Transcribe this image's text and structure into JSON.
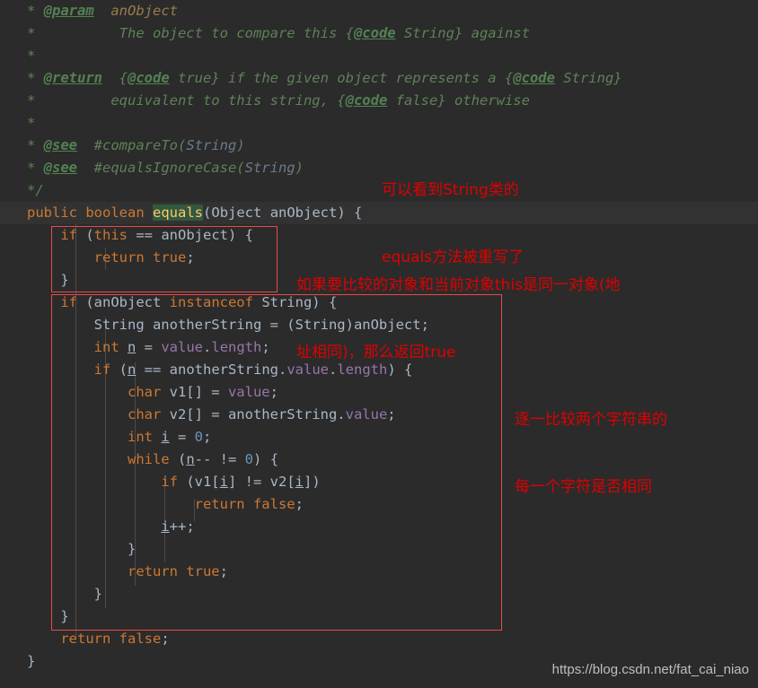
{
  "editor": {
    "theme": "darcula",
    "background_color": "#2b2b2b",
    "current_line_color": "#323232",
    "annotation_color": "#e00000",
    "box_color": "#e84a4a"
  },
  "javadoc": {
    "lines": [
      {
        "star": "*",
        "tag": "@param",
        "text_param": "anObject",
        "text_plain": ""
      },
      {
        "star": "*",
        "tag": "",
        "text_plain": "         The object to compare this {",
        "tag_inline": "@code",
        "text_after": " String} against"
      },
      {
        "star": "*",
        "tag": "",
        "text_plain": ""
      },
      {
        "star": "*",
        "tag": "@return",
        "text_plain": "  {",
        "tag_inline": "@code",
        "text_after": " true} if the given object represents a {",
        "tag_inline2": "@code",
        "text_after2": " String}"
      },
      {
        "star": "*",
        "tag": "",
        "text_plain": "        equivalent to this string, {",
        "tag_inline": "@code",
        "text_after": " false} otherwise"
      },
      {
        "star": "*",
        "tag": "",
        "text_plain": ""
      },
      {
        "star": "*",
        "tag": "@see",
        "text_plain": "  #compareTo(",
        "link": "String",
        "text_after": ")"
      },
      {
        "star": "*",
        "tag": "@see",
        "text_plain": "  #equalsIgnoreCase(",
        "link": "String",
        "text_after": ")"
      }
    ],
    "close": "*/"
  },
  "code": {
    "signature": {
      "modifier": "public",
      "return_type": "boolean",
      "method_name": "equals",
      "params_open": "(",
      "param_type": "Object",
      "param_name": " anObject",
      "params_close": ")",
      "brace": " {"
    },
    "lines": [
      {
        "id": "if-this-eq",
        "indent": 1,
        "tokens": [
          {
            "t": "kw",
            "v": "if"
          },
          {
            "t": "plain",
            "v": " ("
          },
          {
            "t": "kw",
            "v": "this"
          },
          {
            "t": "plain",
            "v": " == anObject)"
          },
          {
            "t": "brace",
            "v": " {"
          }
        ]
      },
      {
        "id": "return-true-1",
        "indent": 2,
        "tokens": [
          {
            "t": "kw",
            "v": "return"
          },
          {
            "t": "kw",
            "v": " true"
          },
          {
            "t": "plain",
            "v": ";"
          }
        ]
      },
      {
        "id": "close-if-this",
        "indent": 1,
        "tokens": [
          {
            "t": "brace",
            "v": "}"
          }
        ]
      },
      {
        "id": "if-instanceof",
        "indent": 1,
        "tokens": [
          {
            "t": "kw",
            "v": "if"
          },
          {
            "t": "plain",
            "v": " (anObject "
          },
          {
            "t": "kw",
            "v": "instanceof"
          },
          {
            "t": "plain",
            "v": " String)"
          },
          {
            "t": "brace",
            "v": " {"
          }
        ]
      },
      {
        "id": "decl-anotherstring",
        "indent": 2,
        "tokens": [
          {
            "t": "plain",
            "v": "String anotherString = (String)anObject;"
          }
        ]
      },
      {
        "id": "decl-n",
        "indent": 2,
        "tokens": [
          {
            "t": "kw",
            "v": "int"
          },
          {
            "t": "plain",
            "v": " "
          },
          {
            "t": "localvar",
            "v": "n"
          },
          {
            "t": "plain",
            "v": " = "
          },
          {
            "t": "field",
            "v": "value"
          },
          {
            "t": "plain",
            "v": "."
          },
          {
            "t": "field",
            "v": "length"
          },
          {
            "t": "plain",
            "v": ";"
          }
        ]
      },
      {
        "id": "if-len-eq",
        "indent": 2,
        "tokens": [
          {
            "t": "kw",
            "v": "if"
          },
          {
            "t": "plain",
            "v": " ("
          },
          {
            "t": "localvar",
            "v": "n"
          },
          {
            "t": "plain",
            "v": " == anotherString."
          },
          {
            "t": "field",
            "v": "value"
          },
          {
            "t": "plain",
            "v": "."
          },
          {
            "t": "field",
            "v": "length"
          },
          {
            "t": "plain",
            "v": ")"
          },
          {
            "t": "brace",
            "v": " {"
          }
        ]
      },
      {
        "id": "decl-v1",
        "indent": 3,
        "tokens": [
          {
            "t": "kw",
            "v": "char"
          },
          {
            "t": "plain",
            "v": " v1[] = "
          },
          {
            "t": "field",
            "v": "value"
          },
          {
            "t": "plain",
            "v": ";"
          }
        ]
      },
      {
        "id": "decl-v2",
        "indent": 3,
        "tokens": [
          {
            "t": "kw",
            "v": "char"
          },
          {
            "t": "plain",
            "v": " v2[] = anotherString."
          },
          {
            "t": "field",
            "v": "value"
          },
          {
            "t": "plain",
            "v": ";"
          }
        ]
      },
      {
        "id": "decl-i",
        "indent": 3,
        "tokens": [
          {
            "t": "kw",
            "v": "int"
          },
          {
            "t": "plain",
            "v": " "
          },
          {
            "t": "localvar",
            "v": "i"
          },
          {
            "t": "plain",
            "v": " = "
          },
          {
            "t": "num",
            "v": "0"
          },
          {
            "t": "plain",
            "v": ";"
          }
        ]
      },
      {
        "id": "while-n",
        "indent": 3,
        "tokens": [
          {
            "t": "kw",
            "v": "while"
          },
          {
            "t": "plain",
            "v": " ("
          },
          {
            "t": "localvar",
            "v": "n"
          },
          {
            "t": "plain",
            "v": "-- != "
          },
          {
            "t": "num",
            "v": "0"
          },
          {
            "t": "plain",
            "v": ")"
          },
          {
            "t": "brace",
            "v": " {"
          }
        ]
      },
      {
        "id": "if-chars-neq",
        "indent": 4,
        "tokens": [
          {
            "t": "kw",
            "v": "if"
          },
          {
            "t": "plain",
            "v": " (v1["
          },
          {
            "t": "localvar",
            "v": "i"
          },
          {
            "t": "plain",
            "v": "] != v2["
          },
          {
            "t": "localvar",
            "v": "i"
          },
          {
            "t": "plain",
            "v": "])"
          }
        ]
      },
      {
        "id": "return-false-inner",
        "indent": 5,
        "tokens": [
          {
            "t": "kw",
            "v": "return"
          },
          {
            "t": "kw",
            "v": " false"
          },
          {
            "t": "plain",
            "v": ";"
          }
        ]
      },
      {
        "id": "incr-i",
        "indent": 4,
        "tokens": [
          {
            "t": "localvar",
            "v": "i"
          },
          {
            "t": "plain",
            "v": "++;"
          }
        ]
      },
      {
        "id": "close-while",
        "indent": 3,
        "tokens": [
          {
            "t": "brace",
            "v": "}"
          }
        ]
      },
      {
        "id": "return-true-2",
        "indent": 3,
        "tokens": [
          {
            "t": "kw",
            "v": "return"
          },
          {
            "t": "kw",
            "v": " true"
          },
          {
            "t": "plain",
            "v": ";"
          }
        ]
      },
      {
        "id": "close-if-len",
        "indent": 2,
        "tokens": [
          {
            "t": "brace",
            "v": "}"
          }
        ]
      },
      {
        "id": "close-if-instanceof",
        "indent": 1,
        "tokens": [
          {
            "t": "brace",
            "v": "}"
          }
        ]
      },
      {
        "id": "return-false-outer",
        "indent": 1,
        "tokens": [
          {
            "t": "kw",
            "v": "return"
          },
          {
            "t": "kw",
            "v": " false"
          },
          {
            "t": "plain",
            "v": ";"
          }
        ]
      },
      {
        "id": "close-method",
        "indent": 0,
        "tokens": [
          {
            "t": "brace",
            "v": "}"
          }
        ]
      }
    ]
  },
  "annotations": [
    {
      "id": "note-equals-overridden",
      "line1": "可以看到String类的",
      "line2": "equals方法被重写了"
    },
    {
      "id": "note-same-object",
      "line1": "如果要比较的对象和当前对象this是同一对象(地",
      "line2": "址相同)，那么返回true"
    },
    {
      "id": "note-compare-char-by-char",
      "line1": "逐一比较两个字符串的",
      "line2": "每一个字符是否相同"
    }
  ],
  "watermark": {
    "url": "https://blog.csdn.net/fat_cai_niao"
  }
}
